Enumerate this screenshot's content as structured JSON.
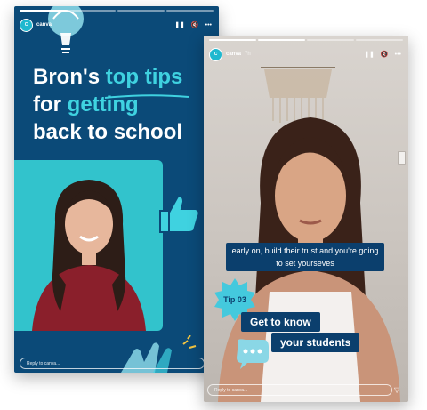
{
  "stories": [
    {
      "id": "left",
      "account": {
        "name": "canva",
        "time": "",
        "avatar_text": "C"
      },
      "controls": {
        "pause": "❚❚",
        "mute": "🔇",
        "more": "•••"
      },
      "headline": {
        "line1_a": "Bron's ",
        "line1_b": "top tips",
        "line2_a": "for ",
        "line2_b": "getting",
        "line3": "back to school"
      },
      "reply_placeholder": "Reply to canva...",
      "colors": {
        "background": "#0b4a78",
        "accent": "#3fd2e0",
        "panel": "#32c3cc"
      }
    },
    {
      "id": "right",
      "account": {
        "name": "canva",
        "time": "7h",
        "avatar_text": "C"
      },
      "controls": {
        "pause": "❚❚",
        "mute": "🔇",
        "more": "•••"
      },
      "caption": "early on, build their trust and you're going to set yourseves",
      "tip_badge": "Tip 03",
      "tip_line1": "Get to know",
      "tip_line2": "your students",
      "reply_placeholder": "Reply to canva...",
      "send_icon": "▽",
      "colors": {
        "label_bg": "#0b3f6d",
        "badge": "#44c9dd"
      }
    }
  ]
}
